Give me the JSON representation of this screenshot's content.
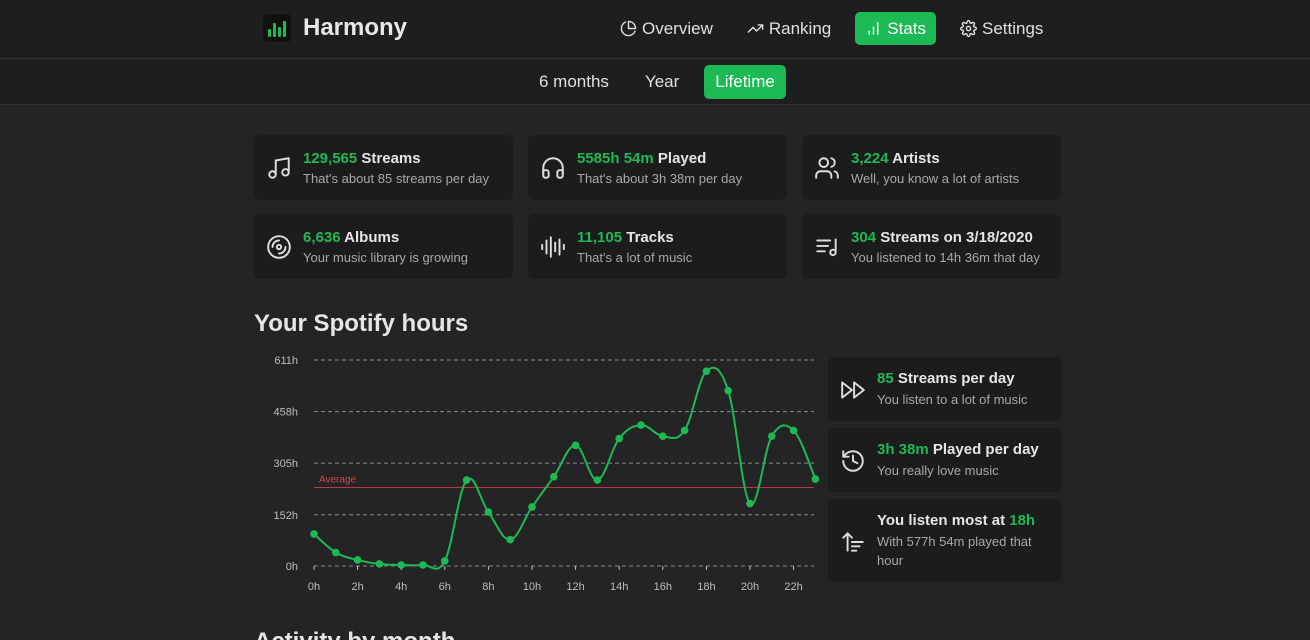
{
  "app": {
    "name": "Harmony"
  },
  "nav": {
    "items": [
      {
        "label": "Overview",
        "icon": "pie-chart-icon",
        "active": false
      },
      {
        "label": "Ranking",
        "icon": "trending-up-icon",
        "active": false
      },
      {
        "label": "Stats",
        "icon": "bar-chart-icon",
        "active": true
      },
      {
        "label": "Settings",
        "icon": "gear-icon",
        "active": false
      }
    ]
  },
  "range_tabs": [
    {
      "label": "6 months",
      "active": false
    },
    {
      "label": "Year",
      "active": false
    },
    {
      "label": "Lifetime",
      "active": true
    }
  ],
  "stat_cards": [
    {
      "value": "129,565",
      "label": " Streams",
      "sub": "That's about 85 streams per day",
      "icon": "music-note-icon"
    },
    {
      "value": "5585h 54m",
      "label": " Played",
      "sub": "That's about 3h 38m per day",
      "icon": "headphones-icon"
    },
    {
      "value": "3,224",
      "label": " Artists",
      "sub": "Well, you know a lot of artists",
      "icon": "users-icon"
    },
    {
      "value": "6,636",
      "label": " Albums",
      "sub": "Your music library is growing",
      "icon": "disc-icon"
    },
    {
      "value": "11,105",
      "label": " Tracks",
      "sub": "That's a lot of music",
      "icon": "audio-lines-icon"
    },
    {
      "value": "304",
      "label": " Streams on 3/18/2020",
      "sub": "You listened to 14h 36m that day",
      "icon": "list-music-icon"
    }
  ],
  "section": {
    "hours_title": "Your Spotify hours",
    "activity_title": "Activity by month"
  },
  "side_cards": [
    {
      "prefix": "",
      "value": "85",
      "label": " Streams per day",
      "sub": "You listen to a lot of music",
      "icon": "fast-forward-icon"
    },
    {
      "prefix": "",
      "value": "3h 38m",
      "label": " Played per day",
      "sub": "You really love music",
      "icon": "history-icon"
    },
    {
      "prefix": "You listen most at ",
      "value": "18h",
      "label": "",
      "sub": "With 577h 54m played that hour",
      "icon": "sort-ascending-icon"
    }
  ],
  "colors": {
    "accent": "#1db954",
    "average": "#d64545",
    "background": "#242424",
    "card": "#1c1c1c"
  },
  "chart_data": {
    "type": "line",
    "x": [
      "0h",
      "1h",
      "2h",
      "3h",
      "4h",
      "5h",
      "6h",
      "7h",
      "8h",
      "9h",
      "10h",
      "11h",
      "12h",
      "13h",
      "14h",
      "15h",
      "16h",
      "17h",
      "18h",
      "19h",
      "20h",
      "21h",
      "22h",
      "23h"
    ],
    "x_tick_labels": [
      "0h",
      "2h",
      "4h",
      "6h",
      "8h",
      "10h",
      "12h",
      "14h",
      "16h",
      "18h",
      "20h",
      "22h"
    ],
    "values": [
      95,
      40,
      18,
      6,
      3,
      3,
      15,
      255,
      160,
      78,
      175,
      265,
      358,
      255,
      378,
      418,
      385,
      402,
      578,
      520,
      185,
      385,
      402,
      258
    ],
    "ylim": [
      0,
      611
    ],
    "y_ticks": [
      0,
      152,
      305,
      458,
      611
    ],
    "y_tick_labels": [
      "0h",
      "152h",
      "305h",
      "458h",
      "611h"
    ],
    "average": 233,
    "average_label": "Average",
    "grid": true,
    "smooth": true
  }
}
